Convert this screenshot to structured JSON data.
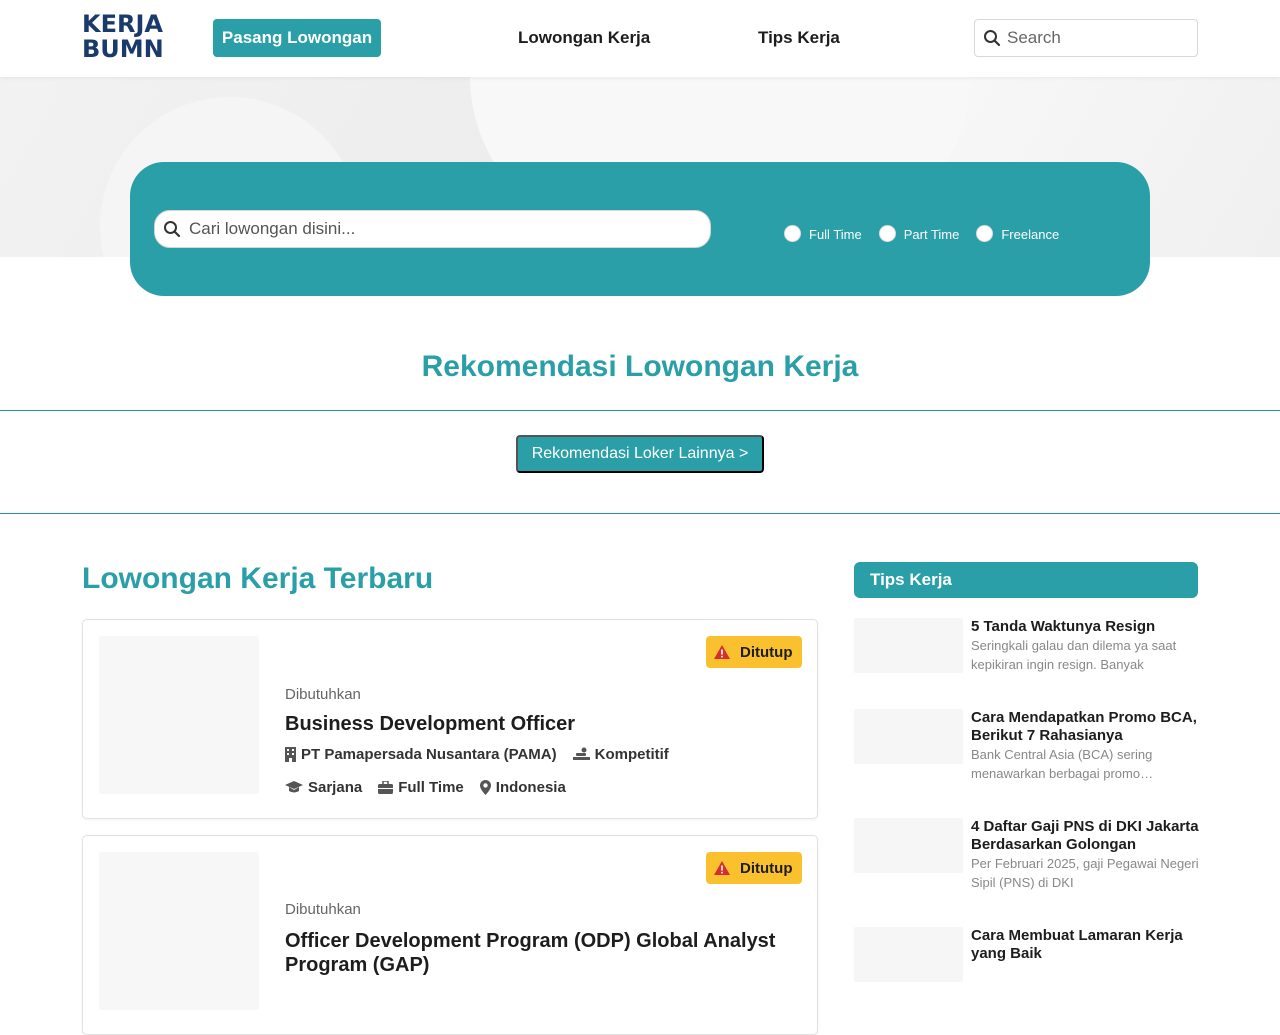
{
  "header": {
    "logo": {
      "line1": "KERJA",
      "line2": "BUMN"
    },
    "post_job_label": "Pasang Lowongan",
    "nav": [
      "Lowongan Kerja",
      "Tips Kerja"
    ],
    "search_placeholder": "Search"
  },
  "hero": {
    "search_placeholder": "Cari lowongan disini...",
    "job_types": [
      "Full Time",
      "Part Time",
      "Freelance"
    ]
  },
  "recommendation": {
    "title": "Rekomendasi Lowongan Kerja",
    "more_button": "Rekomendasi Loker Lainnya >"
  },
  "latest": {
    "title": "Lowongan Kerja Terbaru",
    "jobs": [
      {
        "status": "Ditutup",
        "needed_label": "Dibutuhkan",
        "title": "Business Development Officer",
        "company": "PT Pamapersada Nusantara (PAMA)",
        "salary": "Kompetitif",
        "education": "Sarjana",
        "type": "Full Time",
        "location": "Indonesia"
      },
      {
        "status": "Ditutup",
        "needed_label": "Dibutuhkan",
        "title": "Officer Development Program (ODP) Global Analyst Program (GAP)"
      }
    ]
  },
  "tips": {
    "header": "Tips Kerja",
    "items": [
      {
        "title": "5 Tanda Waktunya Resign",
        "excerpt": "Seringkali galau dan dilema ya saat kepikiran ingin resign. Banyak"
      },
      {
        "title": "Cara Mendapatkan Promo BCA, Berikut 7 Rahasianya",
        "excerpt": "Bank Central Asia (BCA) sering menawarkan berbagai promo…"
      },
      {
        "title": "4 Daftar Gaji PNS di DKI Jakarta Berdasarkan Golongan",
        "excerpt": "Per Februari 2025, gaji Pegawai Negeri Sipil (PNS) di DKI"
      },
      {
        "title": "Cara Membuat Lamaran Kerja yang Baik",
        "excerpt": ""
      }
    ]
  },
  "colors": {
    "primary": "#2a9fa8",
    "badge": "#fbc02d",
    "logo_dark": "#1a3a6b"
  },
  "icons": [
    "search-icon",
    "warning-icon",
    "building-icon",
    "salary-icon",
    "graduation-cap-icon",
    "briefcase-icon",
    "location-pin-icon"
  ]
}
